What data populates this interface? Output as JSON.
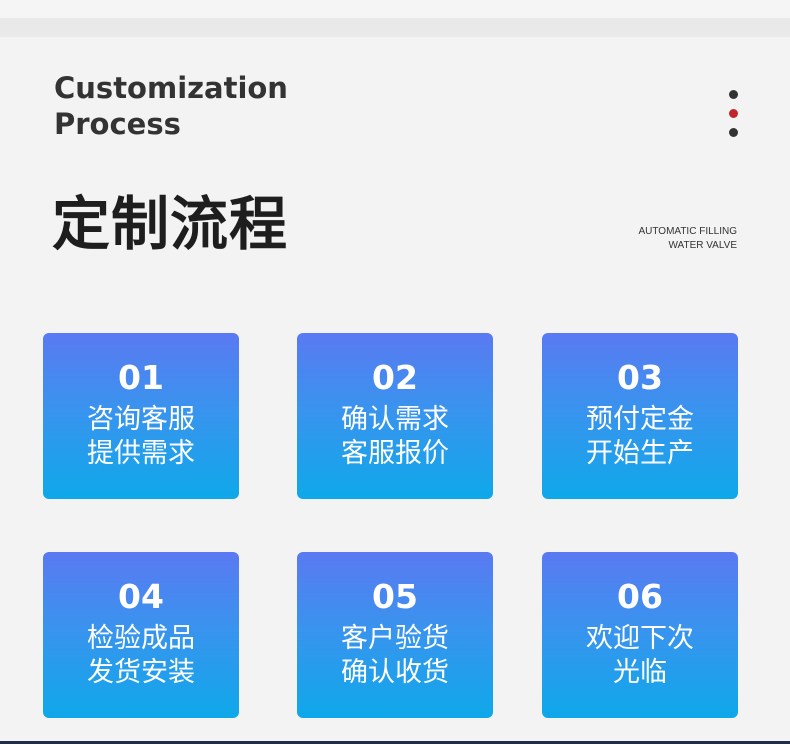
{
  "header": {
    "en_title_line1": "Customization",
    "en_title_line2": "Process",
    "cn_title": "定制流程",
    "brand_line1": "AUTOMATIC FILLING",
    "brand_line2": "WATER VALVE"
  },
  "decor": {
    "dot_colors": [
      "#333333",
      "#c0272d",
      "#333333"
    ],
    "card_gradient": [
      "#5a79f2",
      "#0ea8ea"
    ]
  },
  "steps": [
    {
      "num": "01",
      "line1": "咨询客服",
      "line2": "提供需求"
    },
    {
      "num": "02",
      "line1": "确认需求",
      "line2": "客服报价"
    },
    {
      "num": "03",
      "line1": "预付定金",
      "line2": "开始生产"
    },
    {
      "num": "04",
      "line1": "检验成品",
      "line2": "发货安装"
    },
    {
      "num": "05",
      "line1": "客户验货",
      "line2": "确认收货"
    },
    {
      "num": "06",
      "line1": "欢迎下次",
      "line2": "光临"
    }
  ]
}
